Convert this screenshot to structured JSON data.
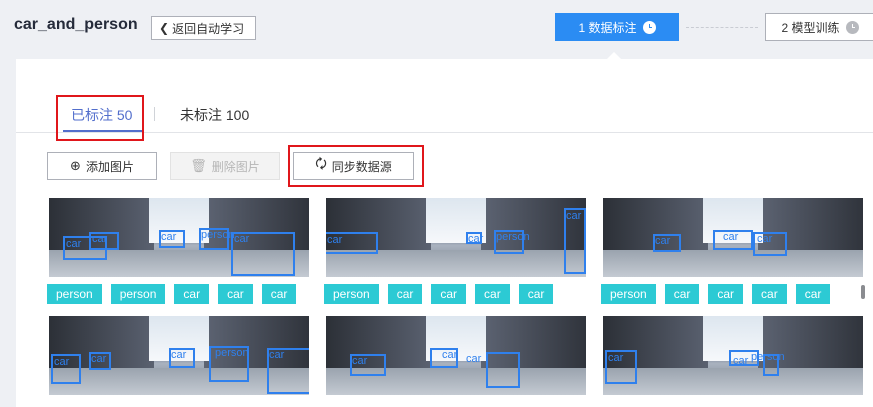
{
  "header": {
    "title": "car_and_person",
    "back_label": "返回自动学习",
    "steps": [
      {
        "label": "1 数据标注",
        "active": true
      },
      {
        "label": "2 模型训练",
        "active": false
      }
    ]
  },
  "tabs": {
    "labeled": "已标注 50",
    "unlabeled": "未标注 100"
  },
  "toolbar": {
    "add_label": "添加图片",
    "delete_label": "删除图片",
    "sync_label": "同步数据源"
  },
  "images": [
    {
      "tags": [
        "person",
        "person",
        "car",
        "car",
        "car"
      ],
      "box_labels": [
        "car",
        "car",
        "car",
        "person",
        "car"
      ]
    },
    {
      "tags": [
        "person",
        "car",
        "car",
        "car",
        "car"
      ],
      "box_labels": [
        "car",
        "car",
        "person",
        "car"
      ]
    },
    {
      "tags": [
        "person",
        "car",
        "car",
        "car",
        "car"
      ],
      "box_labels": [
        "car",
        "car",
        "car"
      ]
    },
    {
      "tags": [],
      "box_labels": [
        "car",
        "car",
        "car",
        "person",
        "car"
      ]
    },
    {
      "tags": [],
      "box_labels": [
        "car",
        "car",
        "car"
      ]
    },
    {
      "tags": [],
      "box_labels": [
        "car",
        "person",
        "car"
      ]
    }
  ],
  "colors": {
    "accent": "#526ecc",
    "step_active": "#2b8cf3",
    "tag": "#2ccad4",
    "bbox": "#2f80ed",
    "highlight": "#e0161b"
  }
}
